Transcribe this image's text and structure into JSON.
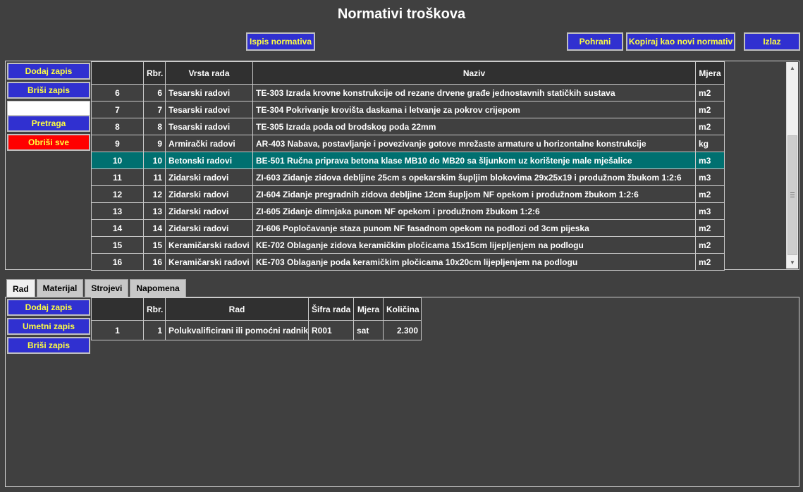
{
  "title": "Normativi troškova",
  "toolbar": {
    "print": "Ispis normativa",
    "save": "Pohrani",
    "copy": "Kopiraj kao novi normativ",
    "exit": "Izlaz"
  },
  "top_side": {
    "add": "Dodaj zapis",
    "delete": "Briši zapis",
    "search_value": "",
    "search": "Pretraga",
    "delete_all": "Obriši sve"
  },
  "top_table": {
    "headers": [
      "",
      "Rbr.",
      "Vrsta rada",
      "Naziv",
      "Mjera"
    ],
    "rows": [
      {
        "id": "6",
        "rbr": "6",
        "vrsta": "Tesarski radovi",
        "naziv": "TE-303 Izrada krovne konstrukcije od rezane drvene građe jednostavnih statičkih sustava",
        "mjera": "m2"
      },
      {
        "id": "7",
        "rbr": "7",
        "vrsta": "Tesarski radovi",
        "naziv": "TE-304 Pokrivanje krovišta daskama i letvanje za pokrov crijepom",
        "mjera": "m2"
      },
      {
        "id": "8",
        "rbr": "8",
        "vrsta": "Tesarski radovi",
        "naziv": "TE-305 Izrada poda od brodskog poda 22mm",
        "mjera": "m2"
      },
      {
        "id": "9",
        "rbr": "9",
        "vrsta": "Armirački radovi",
        "naziv": "AR-403 Nabava, postavljanje i povezivanje gotove mrežaste armature u horizontalne konstrukcije",
        "mjera": "kg"
      },
      {
        "id": "10",
        "rbr": "10",
        "vrsta": "Betonski radovi",
        "naziv": "BE-501 Ručna priprava betona klase MB10 do MB20 sa šljunkom uz korištenje male mješalice",
        "mjera": "m3"
      },
      {
        "id": "11",
        "rbr": "11",
        "vrsta": "Zidarski radovi",
        "naziv": "ZI-603 Zidanje zidova debljine 25cm s opekarskim šupljim blokovima 29x25x19 i produžnom žbukom 1:2:6",
        "mjera": "m3"
      },
      {
        "id": "12",
        "rbr": "12",
        "vrsta": "Zidarski radovi",
        "naziv": "ZI-604 Zidanje pregradnih zidova debljine 12cm šupljom NF opekom i produžnom žbukom 1:2:6",
        "mjera": "m2"
      },
      {
        "id": "13",
        "rbr": "13",
        "vrsta": "Zidarski radovi",
        "naziv": "ZI-605 Zidanje dimnjaka punom NF opekom i produžnom žbukom 1:2:6",
        "mjera": "m3"
      },
      {
        "id": "14",
        "rbr": "14",
        "vrsta": "Zidarski radovi",
        "naziv": "ZI-606 Popločavanje staza punom NF fasadnom opekom na podlozi od 3cm pijeska",
        "mjera": "m2"
      },
      {
        "id": "15",
        "rbr": "15",
        "vrsta": "Keramičarski radovi",
        "naziv": "KE-702 Oblaganje zidova keramičkim pločicama 15x15cm lijepljenjem na podlogu",
        "mjera": "m2"
      },
      {
        "id": "16",
        "rbr": "16",
        "vrsta": "Keramičarski radovi",
        "naziv": "KE-703 Oblaganje poda keramičkim pločicama 10x20cm lijepljenjem na podlogu",
        "mjera": "m2"
      }
    ]
  },
  "tabs": [
    "Rad",
    "Materijal",
    "Strojevi",
    "Napomena"
  ],
  "bottom_side": {
    "add": "Dodaj zapis",
    "insert": "Umetni zapis",
    "delete": "Briši zapis"
  },
  "bottom_table": {
    "headers": [
      "",
      "Rbr.",
      "Rad",
      "Šifra rada",
      "Mjera",
      "Količina"
    ],
    "rows": [
      {
        "id": "1",
        "rbr": "1",
        "rad": "Polukvalificirani ili pomoćni radnik",
        "sifra": "R001",
        "mjera": "sat",
        "kolicina": "2.300"
      }
    ]
  },
  "colors": {
    "background": "#404040",
    "button": "#3030d0",
    "button_text": "#ffff40",
    "danger": "#ff0000",
    "selected_row": "#007070"
  },
  "icons": {
    "scroll_up": "up-arrow-icon",
    "scroll_down": "down-arrow-icon"
  }
}
